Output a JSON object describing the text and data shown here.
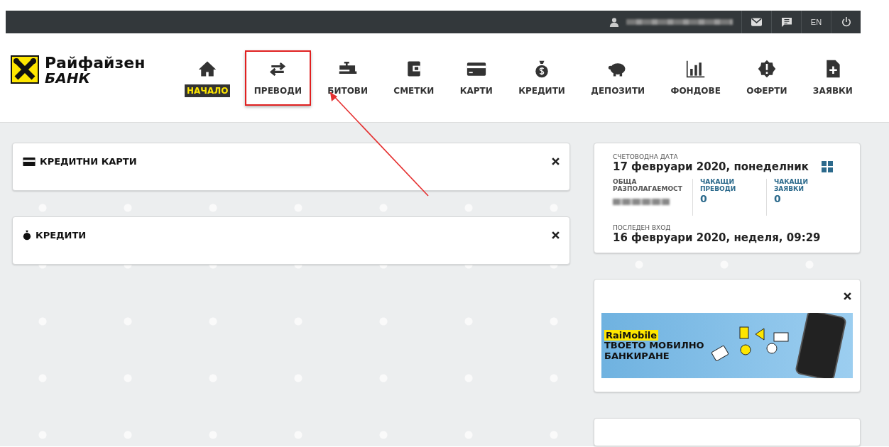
{
  "top_bar": {
    "language": "EN"
  },
  "logo": {
    "line_1": "Райфайзен",
    "line_2": "БАНК"
  },
  "nav": [
    {
      "label": "НАЧАЛО",
      "kind": "home",
      "selected": true,
      "annotated": false
    },
    {
      "label": "ПРЕВОДИ",
      "kind": "arrows",
      "selected": false,
      "annotated": true
    },
    {
      "label": "БИТОВИ",
      "kind": "tap",
      "selected": false,
      "annotated": false
    },
    {
      "label": "СМЕТКИ",
      "kind": "wallet",
      "selected": false,
      "annotated": false
    },
    {
      "label": "КАРТИ",
      "kind": "card",
      "selected": false,
      "annotated": false
    },
    {
      "label": "КРЕДИТИ",
      "kind": "moneybag",
      "selected": false,
      "annotated": false
    },
    {
      "label": "ДЕПОЗИТИ",
      "kind": "piggy",
      "selected": false,
      "annotated": false
    },
    {
      "label": "ФОНДОВЕ",
      "kind": "chart",
      "selected": false,
      "annotated": false
    },
    {
      "label": "ОФЕРТИ",
      "kind": "badge",
      "selected": false,
      "annotated": false
    },
    {
      "label": "ЗАЯВКИ",
      "kind": "file",
      "selected": false,
      "annotated": false
    }
  ],
  "widgets": [
    {
      "title": "КРЕДИТНИ КАРТИ",
      "kind": "card"
    },
    {
      "title": "КРЕДИТИ",
      "kind": "moneybag"
    }
  ],
  "summary": {
    "accounting_date_label": "СЧЕТОВОДНА ДАТА",
    "accounting_date": "17 февруари 2020, понеделник",
    "stats": [
      {
        "label": "ОБЩА РАЗПОЛАГАЕМОСТ",
        "kind": "hidden"
      },
      {
        "label": "ЧАКАЩИ ПРЕВОДИ",
        "kind": "count",
        "value": "0"
      },
      {
        "label": "ЧАКАЩИ ЗАЯВКИ",
        "kind": "count",
        "value": "0"
      }
    ],
    "last_login_label": "ПОСЛЕДЕН ВХОД",
    "last_login": "16 февруари 2020, неделя, 09:29"
  },
  "ad": {
    "brand": "RaiMobile",
    "headline": "ТВОЕТО МОБИЛНО БАНКИРАНЕ"
  }
}
